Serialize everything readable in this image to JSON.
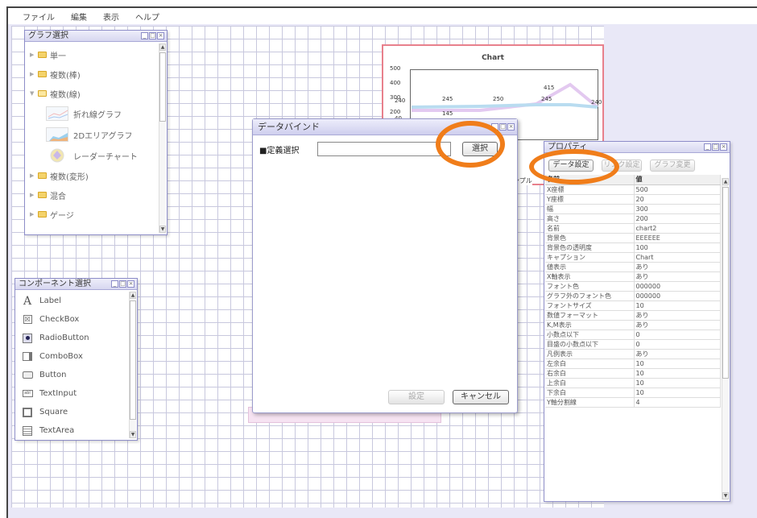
{
  "menu": {
    "items": [
      "ファイル",
      "編集",
      "表示",
      "ヘルプ"
    ]
  },
  "graph_panel": {
    "title": "グラフ選択",
    "tree": [
      {
        "label": "単一",
        "open": false
      },
      {
        "label": "複数(棒)",
        "open": false
      },
      {
        "label": "複数(線)",
        "open": true,
        "children": [
          "折れ線グラフ",
          "2Dエリアグラフ",
          "レーダーチャート"
        ]
      },
      {
        "label": "複数(変形)",
        "open": false
      },
      {
        "label": "混合",
        "open": false
      },
      {
        "label": "ゲージ",
        "open": false
      }
    ]
  },
  "component_panel": {
    "title": "コンポーネント選択",
    "items": [
      "Label",
      "CheckBox",
      "RadioButton",
      "ComboBox",
      "Button",
      "TextInput",
      "Square",
      "TextArea"
    ]
  },
  "chart": {
    "title": "Chart",
    "y_ticks": [
      "500",
      "400",
      "300",
      "200"
    ],
    "labels": [
      "240",
      "245",
      "250",
      "245",
      "240"
    ],
    "labels_upper": [
      "415"
    ],
    "labels_lower": [
      "145",
      "40"
    ],
    "partial_label": "ヤサンプル"
  },
  "dialog": {
    "title": "データバインド",
    "label": "■定義選択",
    "input_value": "",
    "select_button": "選択",
    "ok_button": "設定",
    "cancel_button": "キャンセル"
  },
  "props_panel": {
    "title": "プロパティ",
    "tabs": [
      "データ設定",
      "リンク設定",
      "グラフ変更"
    ],
    "header": {
      "name": "名前",
      "value": "値"
    },
    "rows": [
      [
        "X座標",
        "500"
      ],
      [
        "Y座標",
        "20"
      ],
      [
        "幅",
        "300"
      ],
      [
        "高さ",
        "200"
      ],
      [
        "名前",
        "chart2"
      ],
      [
        "背景色",
        "EEEEEE"
      ],
      [
        "背景色の透明度",
        "100"
      ],
      [
        "キャプション",
        "Chart"
      ],
      [
        "値表示",
        "あり"
      ],
      [
        "X軸表示",
        "あり"
      ],
      [
        "フォント色",
        "000000"
      ],
      [
        "グラフ外のフォント色",
        "000000"
      ],
      [
        "フォントサイズ",
        "10"
      ],
      [
        "数値フォーマット",
        "あり"
      ],
      [
        "K,M表示",
        "あり"
      ],
      [
        "小数点以下",
        "0"
      ],
      [
        "目盛の小数点以下",
        "0"
      ],
      [
        "凡例表示",
        "あり"
      ],
      [
        "左余白",
        "10"
      ],
      [
        "右余白",
        "10"
      ],
      [
        "上余白",
        "10"
      ],
      [
        "下余白",
        "10"
      ],
      [
        "Y軸分割線",
        "4"
      ]
    ]
  },
  "colors": {
    "accent_ring": "#f07d1a",
    "panel_border": "#8d8dc8",
    "chart_border": "#e8808c",
    "grid": "#c8c8de"
  }
}
